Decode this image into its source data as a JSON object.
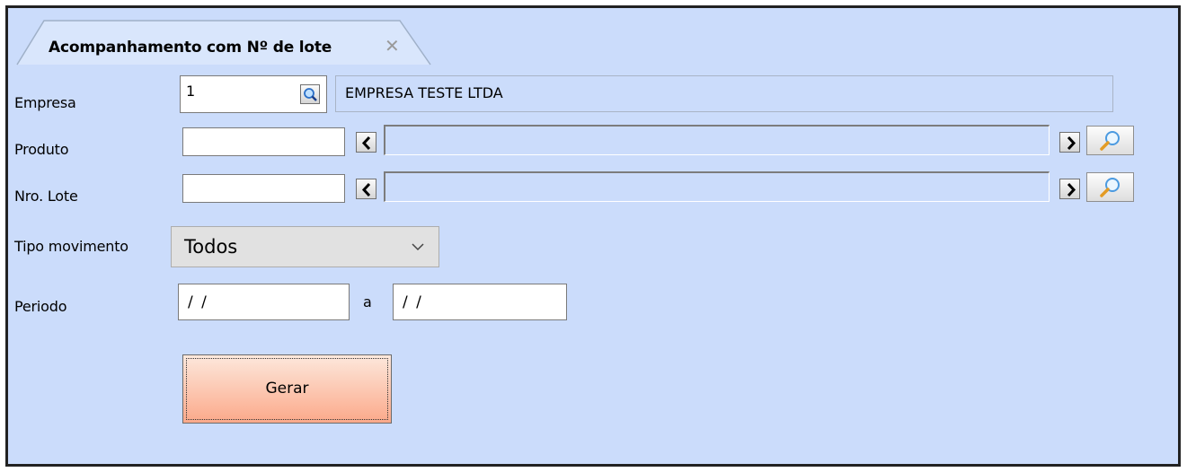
{
  "tab": {
    "title": "Acompanhamento com Nº de lote",
    "close_glyph": "✕"
  },
  "form": {
    "empresa": {
      "label": "Empresa",
      "code": "1",
      "name": "EMPRESA TESTE LTDA"
    },
    "produto": {
      "label": "Produto",
      "code": "",
      "description": ""
    },
    "lote": {
      "label": "Nro. Lote",
      "code": "",
      "description": ""
    },
    "tipo_movimento": {
      "label": "Tipo movimento",
      "selected": "Todos"
    },
    "periodo": {
      "label": "Periodo",
      "start": "/ /",
      "separator": "a",
      "end": "/ /"
    }
  },
  "actions": {
    "gerar_label": "Gerar"
  },
  "icons": {
    "empresa_search": "magnifier-icon",
    "prev": "chevron-left-icon",
    "next": "chevron-right-icon",
    "lookup": "search-icon",
    "dropdown": "chevron-down-icon",
    "close": "close-icon"
  },
  "colors": {
    "background": "#cbdcfb",
    "button_gradient_top": "#fde8dc",
    "button_gradient_bottom": "#fba98a"
  }
}
